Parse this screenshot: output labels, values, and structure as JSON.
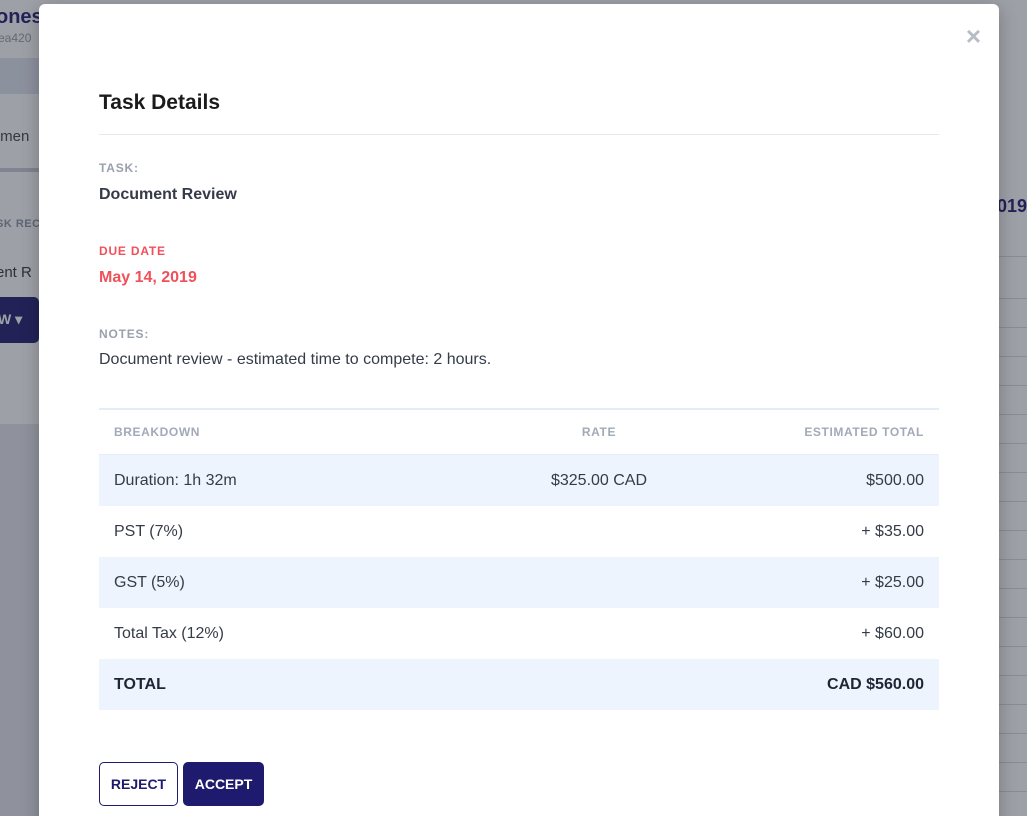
{
  "background": {
    "name_fragment": "ones",
    "id_fragment": "ea420",
    "tab_fragment": "tmen",
    "column_fragment": "SK REC",
    "cell_fragment": "ent R",
    "button_fragment": "W",
    "year_fragment": "019"
  },
  "modal": {
    "close_label": "×",
    "title": "Task Details",
    "task": {
      "label": "TASK:",
      "value": "Document Review"
    },
    "due_date": {
      "label": "DUE DATE",
      "value": "May 14, 2019"
    },
    "notes": {
      "label": "NOTES:",
      "value": "Document review - estimated time to compete: 2 hours."
    },
    "table": {
      "headers": [
        "BREAKDOWN",
        "RATE",
        "ESTIMATED TOTAL"
      ],
      "rows": [
        {
          "breakdown": "Duration: 1h 32m",
          "rate": "$325.00 CAD",
          "total": "$500.00"
        },
        {
          "breakdown": "PST (7%)",
          "rate": "",
          "total": "+ $35.00"
        },
        {
          "breakdown": "GST (5%)",
          "rate": "",
          "total": "+ $25.00"
        },
        {
          "breakdown": "Total Tax (12%)",
          "rate": "",
          "total": "+ $60.00"
        }
      ],
      "total": {
        "label": "TOTAL",
        "value": "CAD $560.00"
      }
    },
    "buttons": {
      "reject": "REJECT",
      "accept": "ACCEPT"
    }
  },
  "colors": {
    "primary": "#1e1b6e",
    "due_date": "#f0505a",
    "row_highlight": "#edf4fd"
  }
}
